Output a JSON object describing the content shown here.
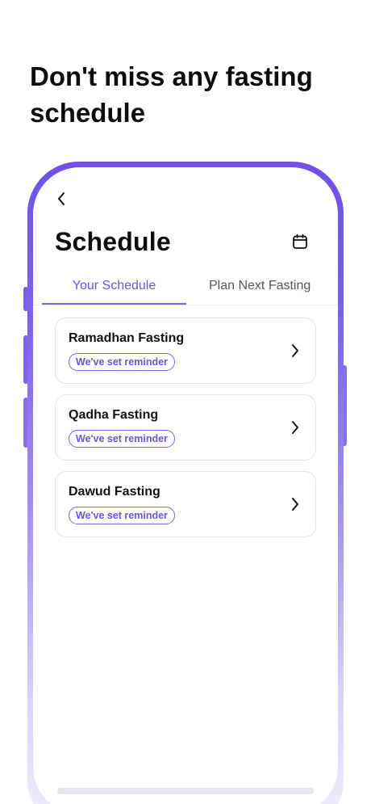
{
  "headline": "Don't miss any fasting\nschedule",
  "screen": {
    "title": "Schedule",
    "back_icon": "chevron-left-icon",
    "calendar_icon": "calendar-icon"
  },
  "tabs": [
    {
      "label": "Your Schedule",
      "active": true
    },
    {
      "label": "Plan Next Fasting",
      "active": false
    }
  ],
  "fastings": [
    {
      "title": "Ramadhan Fasting",
      "badge": "We've set reminder"
    },
    {
      "title": "Qadha Fasting",
      "badge": "We've set reminder"
    },
    {
      "title": "Dawud Fasting",
      "badge": "We've set reminder"
    }
  ],
  "colors": {
    "accent": "#6a54d8",
    "frame_top": "#6f52e6",
    "frame_bottom": "#f4f1fd"
  }
}
